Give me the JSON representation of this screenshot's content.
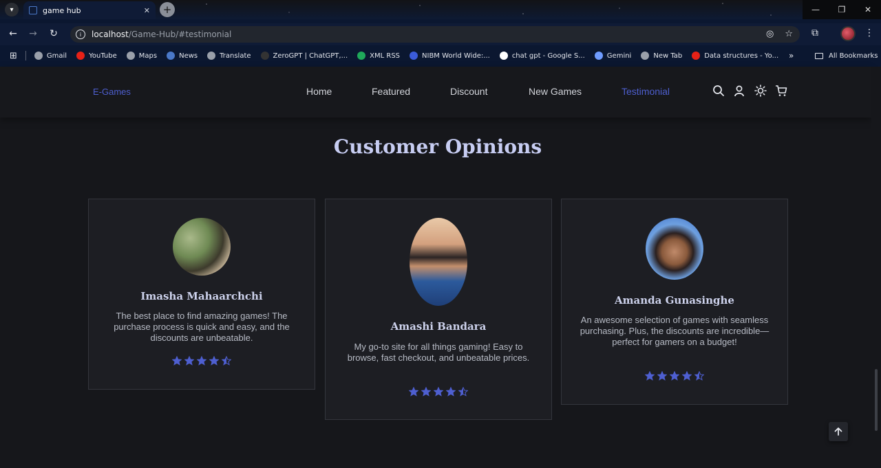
{
  "browser": {
    "tab_title": "game hub",
    "new_tab_glyph": "+",
    "url_host": "localhost",
    "url_path": "/Game-Hub/#testimonial",
    "bookmarks": [
      {
        "label": "Gmail",
        "color": "#9aa0aa"
      },
      {
        "label": "YouTube",
        "color": "#e62117"
      },
      {
        "label": "Maps",
        "color": "#9aa0aa"
      },
      {
        "label": "News",
        "color": "#4a78c8"
      },
      {
        "label": "Translate",
        "color": "#9aa0aa"
      },
      {
        "label": "ZeroGPT | ChatGPT,...",
        "color": "#333333"
      },
      {
        "label": "XML RSS",
        "color": "#1fa85a"
      },
      {
        "label": "NIBM World Wide:...",
        "color": "#3b5bd9"
      },
      {
        "label": "chat gpt - Google S...",
        "color": "#ffffff"
      },
      {
        "label": "Gemini",
        "color": "#6f9cff"
      },
      {
        "label": "New Tab",
        "color": "#9aa0aa"
      },
      {
        "label": "Data structures - Yo...",
        "color": "#e62117"
      }
    ],
    "bookmarks_more": "»",
    "all_bookmarks": "All Bookmarks"
  },
  "site": {
    "brand": "E-Games",
    "nav": [
      "Home",
      "Featured",
      "Discount",
      "New Games",
      "Testimonial"
    ],
    "active_nav": "Testimonial",
    "accent_color": "#4e5fd0",
    "icons": [
      "search-icon",
      "user-icon",
      "theme-toggle-icon",
      "cart-icon"
    ]
  },
  "testimonials": {
    "title": "Customer Opinions",
    "items": [
      {
        "name": "Imasha Mahaarchchi",
        "text": "The best place to find amazing games! The purchase process is quick and easy, and the discounts are unbeatable.",
        "rating": 4.5
      },
      {
        "name": "Amashi Bandara",
        "text": "My go-to site for all things gaming! Easy to browse, fast checkout, and unbeatable prices.",
        "rating": 4.5
      },
      {
        "name": "Amanda Gunasinghe",
        "text": "An awesome selection of games with seamless purchasing. Plus, the discounts are incredible—perfect for gamers on a budget!",
        "rating": 4.5
      }
    ]
  },
  "back_to_top_icon": "arrow-up-icon"
}
